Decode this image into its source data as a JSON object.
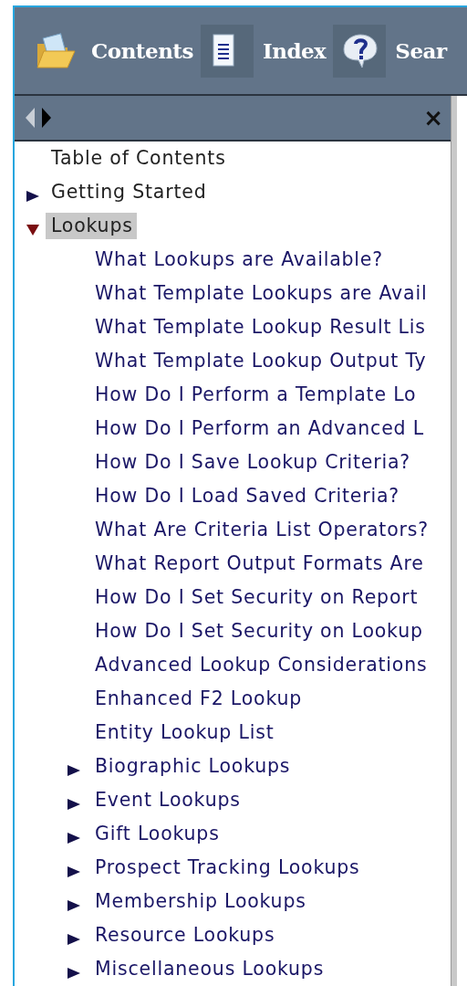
{
  "toolbar": {
    "buttons": [
      {
        "kind": "folder",
        "label": "Contents"
      },
      {
        "kind": "document",
        "label": "Index"
      },
      {
        "kind": "help",
        "label": "Sear"
      }
    ]
  },
  "nav": {
    "back_disabled": true,
    "forward_disabled": false,
    "close": "×"
  },
  "tree": [
    {
      "kind": "topic",
      "label": "Table of Contents",
      "selected": false
    },
    {
      "kind": "book",
      "label": "Getting Started",
      "expanded": false,
      "selected": false
    },
    {
      "kind": "book",
      "label": "Lookups",
      "expanded": true,
      "selected": true,
      "children": [
        {
          "kind": "topic",
          "label": "What Lookups are Available?",
          "selected": false
        },
        {
          "kind": "topic",
          "label": "What Template Lookups are Avail",
          "selected": false
        },
        {
          "kind": "topic",
          "label": "What Template Lookup Result Lis",
          "selected": false
        },
        {
          "kind": "topic",
          "label": "What Template Lookup Output Ty",
          "selected": false
        },
        {
          "kind": "topic",
          "label": "How Do I Perform a Template Lo",
          "selected": false
        },
        {
          "kind": "topic",
          "label": "How Do I Perform an Advanced L",
          "selected": false
        },
        {
          "kind": "topic",
          "label": "How Do I Save Lookup Criteria?",
          "selected": false
        },
        {
          "kind": "topic",
          "label": "How Do I Load Saved Criteria?",
          "selected": false
        },
        {
          "kind": "topic",
          "label": "What Are Criteria List Operators?",
          "selected": false
        },
        {
          "kind": "topic",
          "label": "What Report Output Formats Are",
          "selected": false
        },
        {
          "kind": "topic",
          "label": "How Do I Set Security on Report",
          "selected": false
        },
        {
          "kind": "topic",
          "label": "How Do I Set Security on Lookup",
          "selected": false
        },
        {
          "kind": "topic",
          "label": "Advanced Lookup Considerations",
          "selected": false
        },
        {
          "kind": "topic",
          "label": "Enhanced F2 Lookup",
          "selected": false
        },
        {
          "kind": "topic",
          "label": "Entity Lookup List",
          "selected": false
        },
        {
          "kind": "book",
          "label": "Biographic Lookups",
          "expanded": false,
          "selected": false
        },
        {
          "kind": "book",
          "label": "Event Lookups",
          "expanded": false,
          "selected": false
        },
        {
          "kind": "book",
          "label": "Gift Lookups",
          "expanded": false,
          "selected": false
        },
        {
          "kind": "book",
          "label": "Prospect Tracking Lookups",
          "expanded": false,
          "selected": false
        },
        {
          "kind": "book",
          "label": "Membership Lookups",
          "expanded": false,
          "selected": false
        },
        {
          "kind": "book",
          "label": "Resource Lookups",
          "expanded": false,
          "selected": false
        },
        {
          "kind": "book",
          "label": "Miscellaneous Lookups",
          "expanded": false,
          "selected": false
        }
      ]
    }
  ]
}
